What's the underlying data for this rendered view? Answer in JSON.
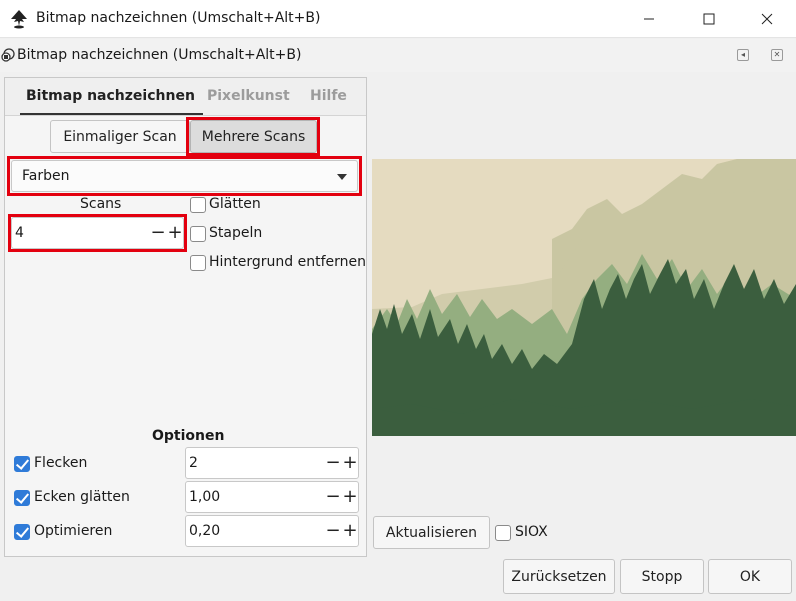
{
  "window": {
    "title": "Bitmap nachzeichnen (Umschalt+Alt+B)"
  },
  "dock": {
    "title": "Bitmap nachzeichnen (Umschalt+Alt+B)"
  },
  "tabs": [
    {
      "label": "Bitmap nachzeichnen",
      "active": true
    },
    {
      "label": "Pixelkunst",
      "active": false
    },
    {
      "label": "Hilfe",
      "active": false
    }
  ],
  "scan_mode": {
    "single": "Einmaliger Scan",
    "multiple": "Mehrere Scans",
    "selected": "Mehrere Scans"
  },
  "mode_select": {
    "value": "Farben"
  },
  "scans": {
    "label": "Scans",
    "value": "4"
  },
  "options_right": [
    {
      "label": "Glätten",
      "checked": false
    },
    {
      "label": "Stapeln",
      "checked": false
    },
    {
      "label": "Hintergrund entfernen",
      "checked": false
    }
  ],
  "optionen": {
    "heading": "Optionen",
    "rows": [
      {
        "label": "Flecken",
        "checked": true,
        "value": "2"
      },
      {
        "label": "Ecken glätten",
        "checked": true,
        "value": "1,00"
      },
      {
        "label": "Optimieren",
        "checked": true,
        "value": "0,20"
      }
    ]
  },
  "preview": {
    "update_label": "Aktualisieren",
    "siox_label": "SIOX",
    "siox_checked": false,
    "colors": [
      "#e5dbc0",
      "#c9c6a2",
      "#94ae80",
      "#3b5e3e"
    ]
  },
  "footer": {
    "reset": "Zurücksetzen",
    "stop": "Stopp",
    "ok": "OK"
  },
  "highlight_color": "#e3000f"
}
